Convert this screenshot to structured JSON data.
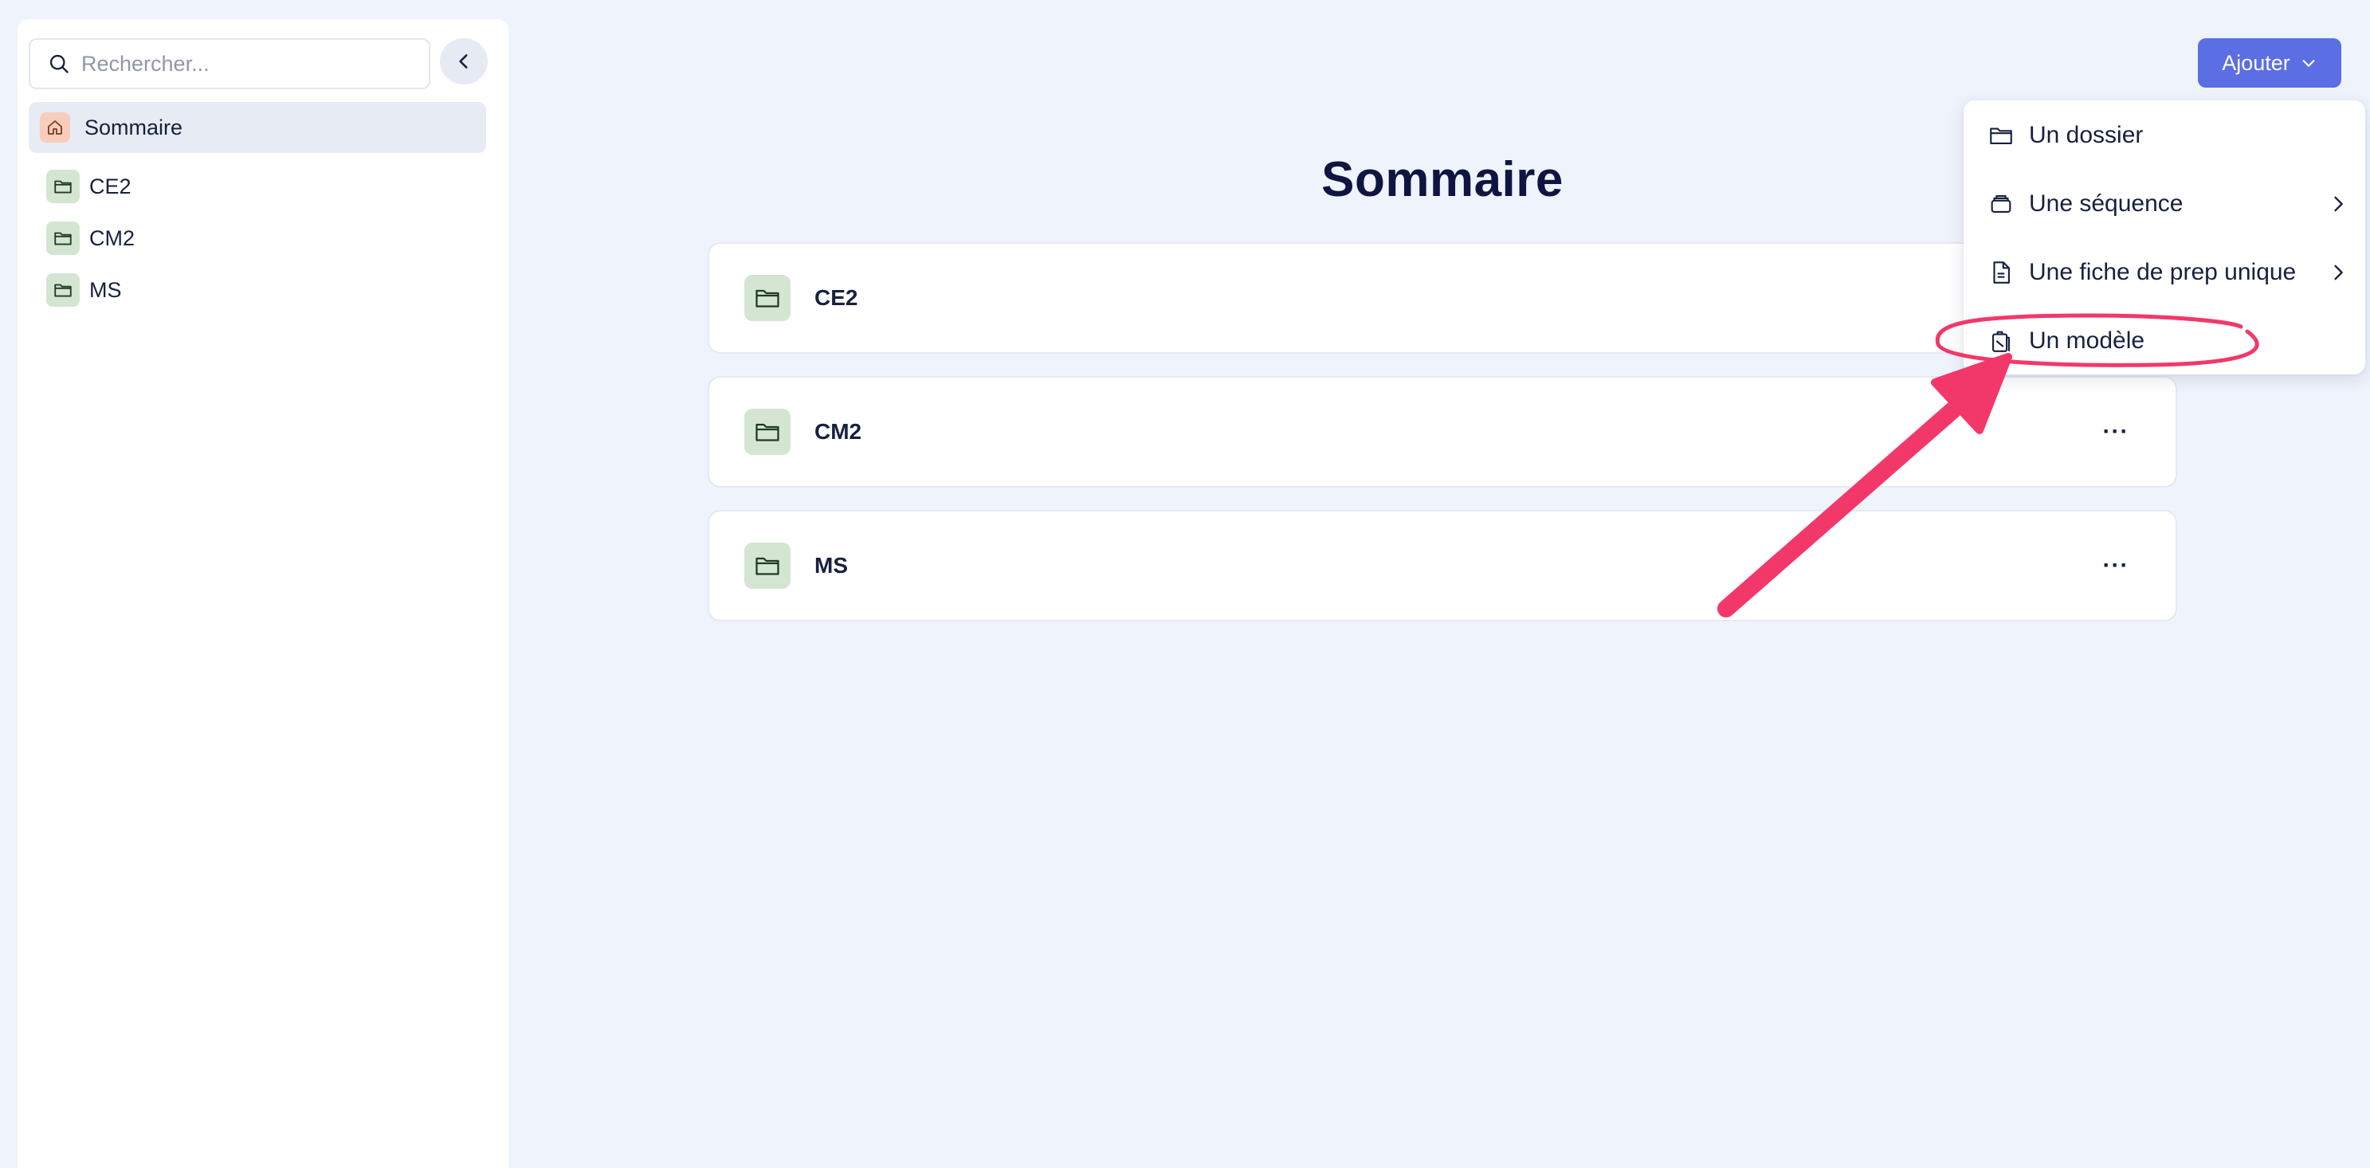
{
  "sidebar": {
    "search_placeholder": "Rechercher...",
    "home_label": "Sommaire",
    "items": [
      {
        "label": "CE2"
      },
      {
        "label": "CM2"
      },
      {
        "label": "MS"
      }
    ]
  },
  "main": {
    "title": "Sommaire",
    "cards": [
      {
        "label": "CE2"
      },
      {
        "label": "CM2",
        "more": "···"
      },
      {
        "label": "MS",
        "more": "···"
      }
    ]
  },
  "toolbar": {
    "add_label": "Ajouter"
  },
  "add_menu": {
    "items": [
      {
        "label": "Un dossier",
        "icon": "folder-icon"
      },
      {
        "label": "Une séquence",
        "icon": "stack-icon",
        "has_submenu": true
      },
      {
        "label": "Une fiche de prep unique",
        "icon": "document-icon",
        "has_submenu": true
      },
      {
        "label": "Un modèle",
        "icon": "template-icon",
        "highlighted": true
      }
    ]
  },
  "colors": {
    "background": "#eff3fc",
    "accent": "#5b6ee3",
    "folder_badge": "#d4e6d2",
    "home_badge": "#f9cdbb",
    "annotation": "#f2386a"
  }
}
